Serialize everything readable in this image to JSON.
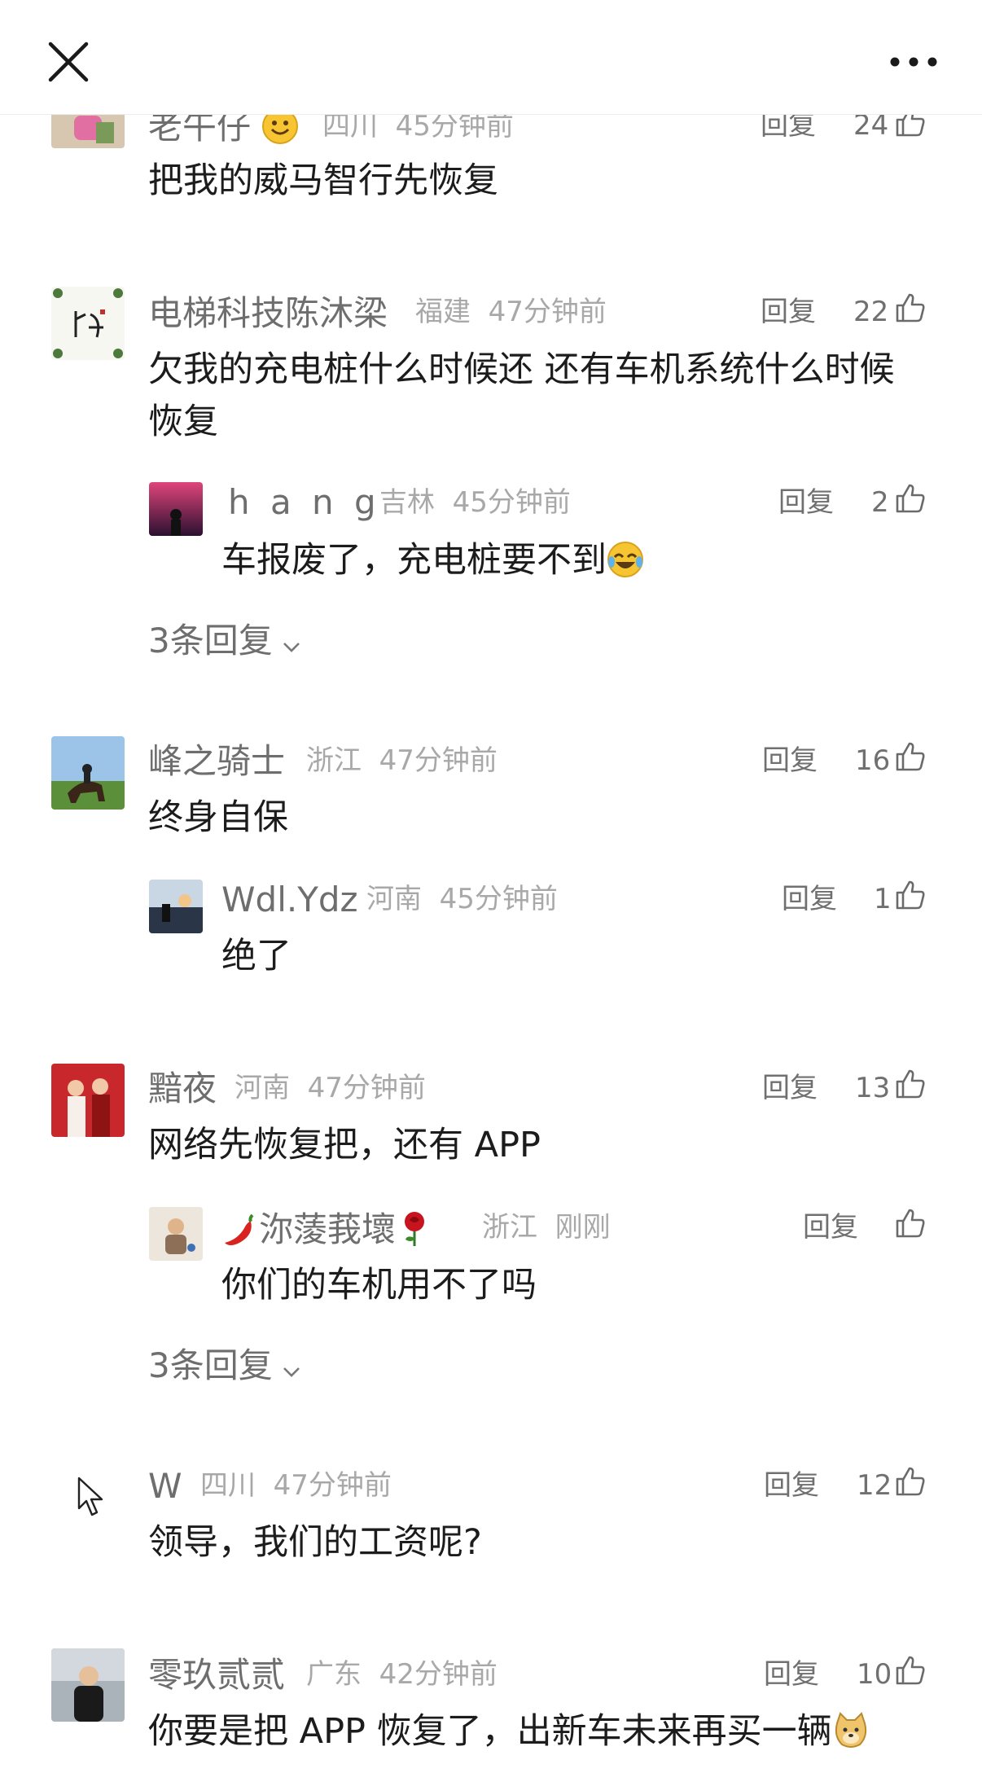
{
  "header": {
    "close_icon": "close-icon",
    "more_icon": "more-dots-icon"
  },
  "comments": [
    {
      "name": "老午仔",
      "region": "四川",
      "time": "45分钟前",
      "reply_label": "回复",
      "likes": "24",
      "text": "把我的威马智行先恢复"
    },
    {
      "name": "电梯科技陈沐梁",
      "region": "福建",
      "time": "47分钟前",
      "reply_label": "回复",
      "likes": "22",
      "text_line1": "欠我的充电桩什么时候还  还有车机系统什么时候",
      "text_line2": "恢复",
      "sub": {
        "name": "h a n g",
        "region": "吉林",
        "time": "45分钟前",
        "reply_label": "回复",
        "likes": "2",
        "text": "车报废了，充电桩要不到"
      },
      "more_replies": "3条回复"
    },
    {
      "name": "峰之骑士",
      "region": "浙江",
      "time": "47分钟前",
      "reply_label": "回复",
      "likes": "16",
      "text": "终身自保",
      "sub": {
        "name": "Wdl.Ydz",
        "region": "河南",
        "time": "45分钟前",
        "reply_label": "回复",
        "likes": "1",
        "text": "绝了"
      }
    },
    {
      "name": "黯夜",
      "region": "河南",
      "time": "47分钟前",
      "reply_label": "回复",
      "likes": "13",
      "text": "网络先恢复把，还有 APP",
      "sub": {
        "name": "沵蔆莪壞",
        "region": "浙江",
        "time": "刚刚",
        "reply_label": "回复",
        "likes": "",
        "text": "你们的车机用不了吗"
      },
      "more_replies": "3条回复"
    },
    {
      "name": "W",
      "region": "四川",
      "time": "47分钟前",
      "reply_label": "回复",
      "likes": "12",
      "text": "领导，我们的工资呢?"
    },
    {
      "name": "零玖贰贰",
      "region": "广东",
      "time": "42分钟前",
      "reply_label": "回复",
      "likes": "10",
      "text": "你要是把 APP 恢复了，出新车未来再买一辆"
    }
  ]
}
